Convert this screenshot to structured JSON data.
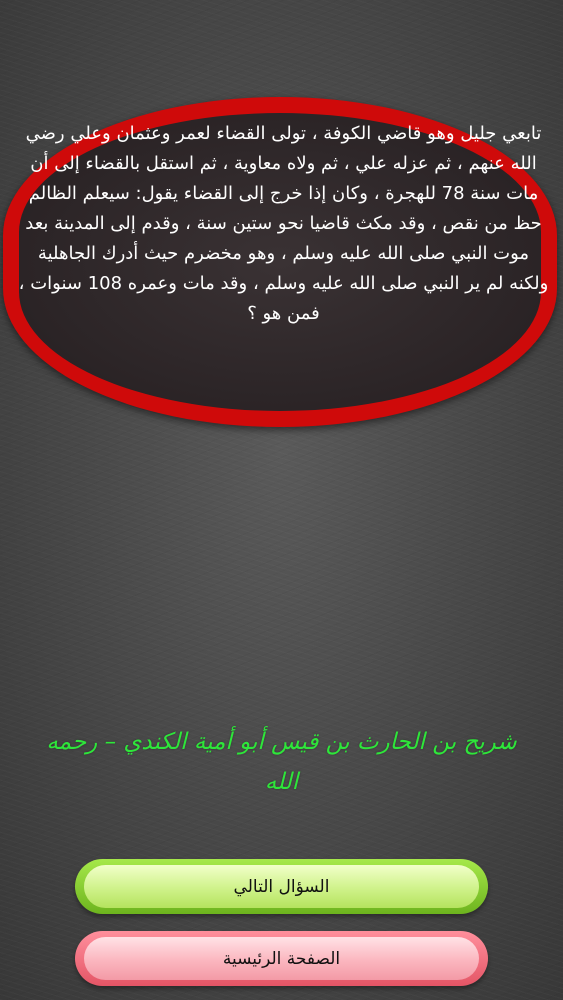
{
  "question": {
    "text": "تابعي جليل وهو قاضي الكوفة ، تولى القضاء لعمر وعثمان وعلي رضي الله عنهم ، ثم عزله علي ، ثم ولاه معاوية ، ثم استقل بالقضاء إلى أن مات سنة 78 للهجرة ، وكان إذا خرج إلى القضاء يقول: سيعلم الظالم حظ من نقص ، وقد مكث قاضيا نحو ستين سنة ، وقدم إلى المدينة بعد موت النبي صلى الله عليه وسلم ، وهو مخضرم حيث أدرك الجاهلية ولكنه لم ير النبي صلى الله عليه وسلم ، وقد مات وعمره 108 سنوات ، فمن هو ؟"
  },
  "answer": {
    "text": "شريح بن الحارث بن قيس أبو أمية الكندي – رحمه الله"
  },
  "buttons": {
    "next_label": "السؤال التالي",
    "home_label": "الصفحة الرئيسية"
  },
  "colors": {
    "bubble_border": "#cf0a0a",
    "answer": "#2ee63a",
    "next_button": "#b5e35e",
    "home_button": "#f39aa6"
  }
}
